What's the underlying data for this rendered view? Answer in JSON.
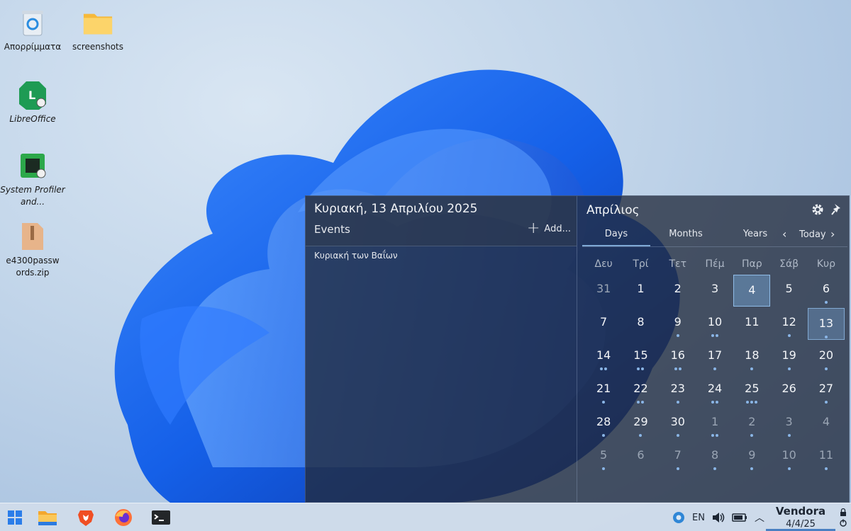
{
  "desktop": {
    "icons": [
      {
        "label": "Απορρίμματα",
        "icon": "trash-icon"
      },
      {
        "label": "screenshots",
        "icon": "folder-icon"
      },
      {
        "label": "LibreOffice",
        "icon": "libreoffice-icon"
      },
      {
        "label": "System Profiler and...",
        "icon": "cpu-icon"
      },
      {
        "label": "e4300passwords.zip",
        "icon": "zip-icon"
      }
    ]
  },
  "calendar_popup": {
    "date_title": "Κυριακή, 13 Απριλίου 2025",
    "events_label": "Events",
    "add_label": "Add...",
    "events": [
      "Κυριακή των Βαΐων"
    ],
    "month_title": "Απρίλιος",
    "tabs": [
      "Days",
      "Months",
      "Years"
    ],
    "active_tab": "Days",
    "today_label": "Today",
    "weekdays": [
      "Δευ",
      "Τρί",
      "Τετ",
      "Πέμ",
      "Παρ",
      "Σάβ",
      "Κυρ"
    ],
    "weeks": [
      [
        {
          "d": "31",
          "o": true,
          "n": 0
        },
        {
          "d": "1",
          "n": 0
        },
        {
          "d": "2",
          "n": 0
        },
        {
          "d": "3",
          "n": 0
        },
        {
          "d": "4",
          "n": 0,
          "today": true
        },
        {
          "d": "5",
          "n": 0
        },
        {
          "d": "6",
          "n": 1
        }
      ],
      [
        {
          "d": "7",
          "n": 0
        },
        {
          "d": "8",
          "n": 0
        },
        {
          "d": "9",
          "n": 1
        },
        {
          "d": "10",
          "n": 2
        },
        {
          "d": "11",
          "n": 0
        },
        {
          "d": "12",
          "n": 1
        },
        {
          "d": "13",
          "n": 1,
          "sel": true
        }
      ],
      [
        {
          "d": "14",
          "n": 2
        },
        {
          "d": "15",
          "n": 2
        },
        {
          "d": "16",
          "n": 2
        },
        {
          "d": "17",
          "n": 1
        },
        {
          "d": "18",
          "n": 1
        },
        {
          "d": "19",
          "n": 1
        },
        {
          "d": "20",
          "n": 1
        }
      ],
      [
        {
          "d": "21",
          "n": 1
        },
        {
          "d": "22",
          "n": 2
        },
        {
          "d": "23",
          "n": 1
        },
        {
          "d": "24",
          "n": 2
        },
        {
          "d": "25",
          "n": 3
        },
        {
          "d": "26",
          "n": 0
        },
        {
          "d": "27",
          "n": 1
        }
      ],
      [
        {
          "d": "28",
          "n": 1
        },
        {
          "d": "29",
          "n": 1
        },
        {
          "d": "30",
          "n": 1
        },
        {
          "d": "1",
          "o": true,
          "n": 2
        },
        {
          "d": "2",
          "o": true,
          "n": 1
        },
        {
          "d": "3",
          "o": true,
          "n": 1
        },
        {
          "d": "4",
          "o": true,
          "n": 0
        }
      ],
      [
        {
          "d": "5",
          "o": true,
          "n": 1
        },
        {
          "d": "6",
          "o": true,
          "n": 0
        },
        {
          "d": "7",
          "o": true,
          "n": 1
        },
        {
          "d": "8",
          "o": true,
          "n": 1
        },
        {
          "d": "9",
          "o": true,
          "n": 1
        },
        {
          "d": "10",
          "o": true,
          "n": 1
        },
        {
          "d": "11",
          "o": true,
          "n": 1
        }
      ]
    ]
  },
  "taskbar": {
    "apps": [
      "start-menu-icon",
      "file-manager-icon",
      "brave-browser-icon",
      "firefox-icon",
      "terminal-icon"
    ],
    "language": "EN",
    "clock_time": "Vendora",
    "clock_date": "4/4/25"
  },
  "colors": {
    "accent": "#7fa9d6",
    "popup_bg": "#222c3e",
    "event_dot": "#8ab5e6"
  }
}
